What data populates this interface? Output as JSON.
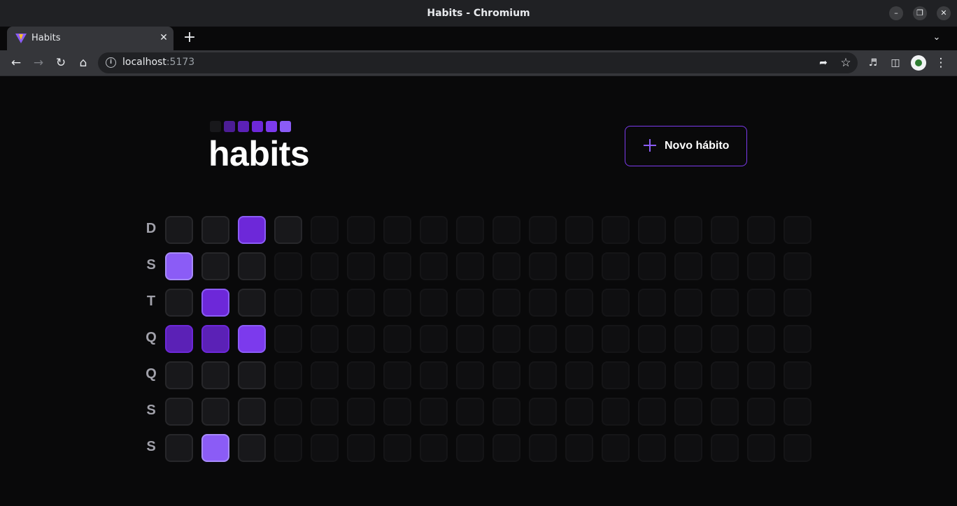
{
  "window": {
    "title": "Habits - Chromium"
  },
  "tab": {
    "title": "Habits"
  },
  "address": {
    "host": "localhost",
    "port": ":5173"
  },
  "app": {
    "logo_text": "habits",
    "new_habit_label": "Novo hábito",
    "logo_square_colors": [
      "#18181b",
      "#4c1d95",
      "#5b21b6",
      "#6d28d9",
      "#7c3aed",
      "#8b5cf6"
    ],
    "weekdays": [
      "D",
      "S",
      "T",
      "Q",
      "Q",
      "S",
      "S"
    ],
    "summary": {
      "columns": 18,
      "completion_levels": [
        [
          0,
          0,
          3,
          0,
          null,
          null,
          null,
          null,
          null,
          null,
          null,
          null,
          null,
          null,
          null,
          null,
          null,
          null
        ],
        [
          5,
          0,
          0,
          null,
          null,
          null,
          null,
          null,
          null,
          null,
          null,
          null,
          null,
          null,
          null,
          null,
          null,
          null
        ],
        [
          0,
          3,
          0,
          null,
          null,
          null,
          null,
          null,
          null,
          null,
          null,
          null,
          null,
          null,
          null,
          null,
          null,
          null
        ],
        [
          2,
          2,
          4,
          null,
          null,
          null,
          null,
          null,
          null,
          null,
          null,
          null,
          null,
          null,
          null,
          null,
          null,
          null
        ],
        [
          0,
          0,
          0,
          null,
          null,
          null,
          null,
          null,
          null,
          null,
          null,
          null,
          null,
          null,
          null,
          null,
          null,
          null
        ],
        [
          0,
          0,
          0,
          null,
          null,
          null,
          null,
          null,
          null,
          null,
          null,
          null,
          null,
          null,
          null,
          null,
          null,
          null
        ],
        [
          0,
          5,
          0,
          null,
          null,
          null,
          null,
          null,
          null,
          null,
          null,
          null,
          null,
          null,
          null,
          null,
          null,
          null
        ]
      ],
      "level_colors": {
        "0": {
          "bg": "#18181b",
          "border": "#27272a"
        },
        "1": {
          "bg": "#4c1d95",
          "border": "#6d28d9"
        },
        "2": {
          "bg": "#5b21b6",
          "border": "#6d28d9"
        },
        "3": {
          "bg": "#6d28d9",
          "border": "#8b5cf6"
        },
        "4": {
          "bg": "#7c3aed",
          "border": "#8b5cf6"
        },
        "5": {
          "bg": "#8b5cf6",
          "border": "#a78bfa"
        }
      }
    }
  }
}
